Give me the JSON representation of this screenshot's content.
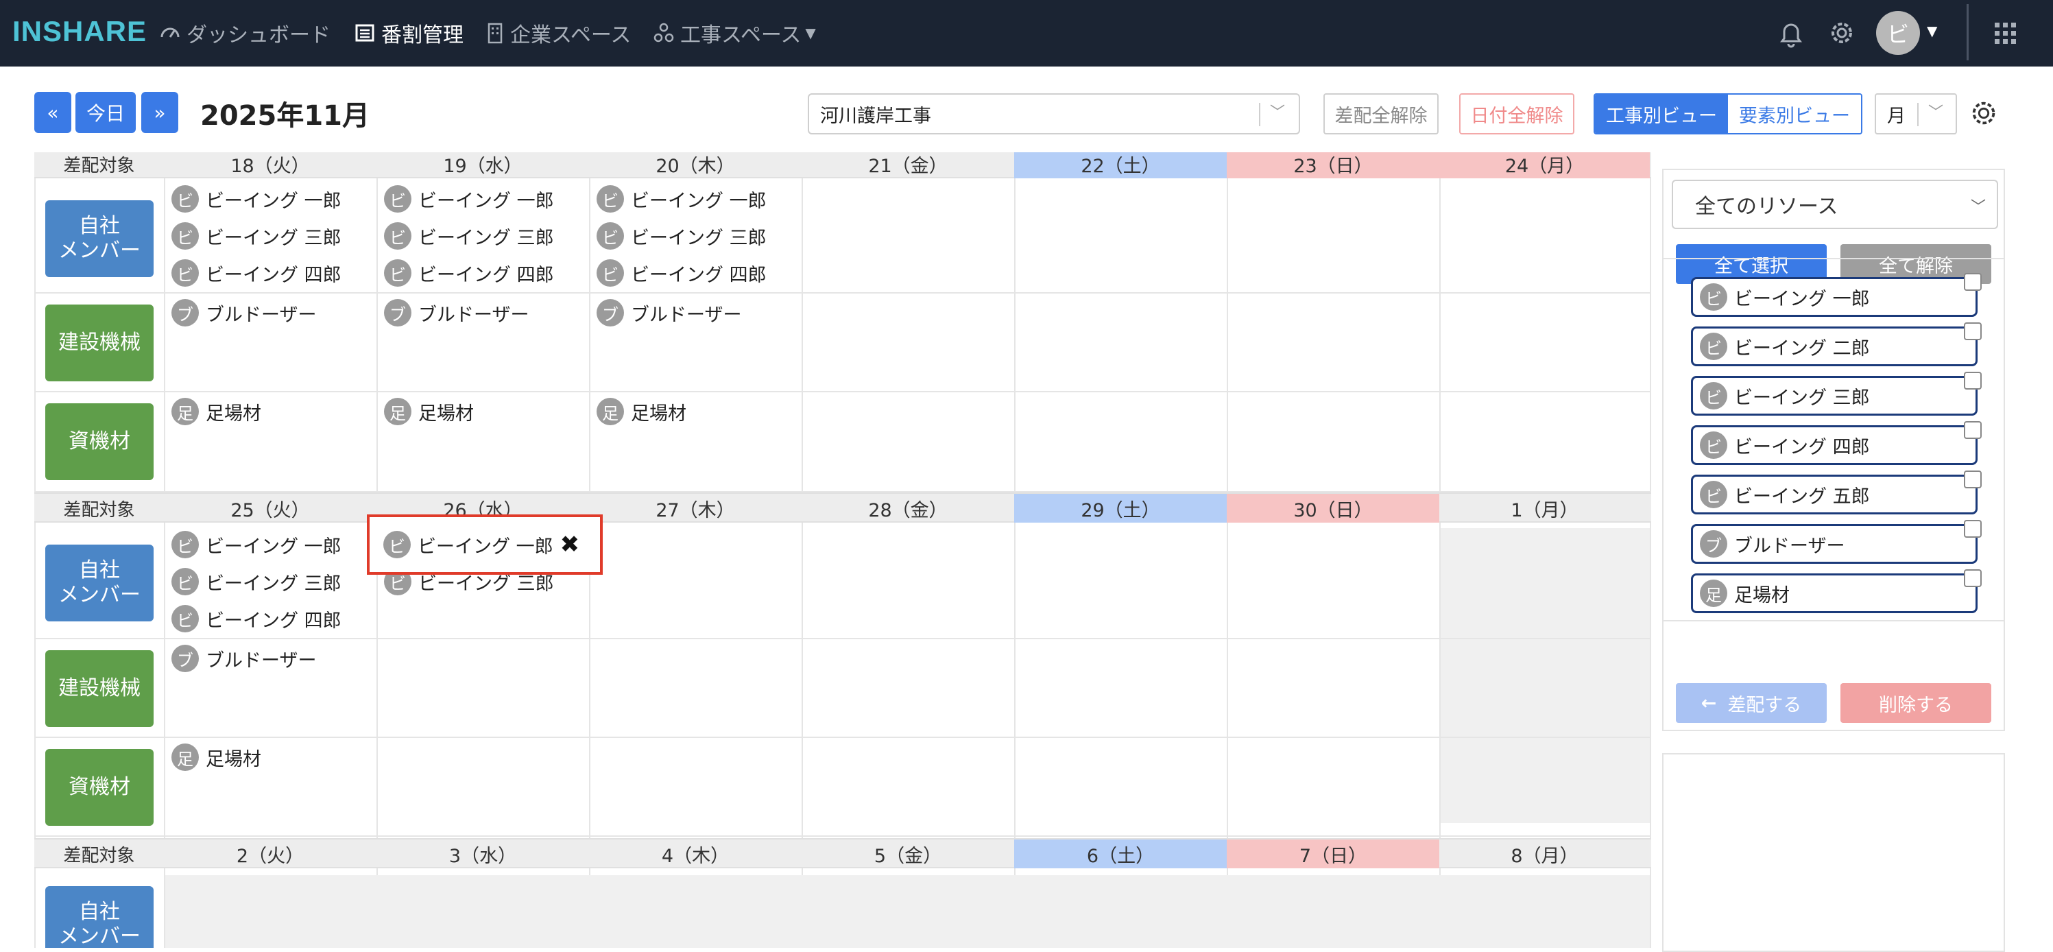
{
  "nav": {
    "logo": "INSHARE",
    "items": [
      {
        "label": "ダッシュボード",
        "icon": "dashboard-icon"
      },
      {
        "label": "番割管理",
        "icon": "list-icon"
      },
      {
        "label": "企業スペース",
        "icon": "building-icon"
      },
      {
        "label": "工事スペース",
        "icon": "network-icon"
      }
    ],
    "avatar": "ビ"
  },
  "toolbar": {
    "prev": "«",
    "today": "今日",
    "next": "»",
    "month_title": "2025年11月",
    "project": "河川護岸工事",
    "clear_assign": "差配全解除",
    "clear_date": "日付全解除",
    "view_by_project": "工事別ビュー",
    "view_by_element": "要素別ビュー",
    "period": "月"
  },
  "calendar": {
    "row_label": "差配対象",
    "categories": {
      "members": "自社\nメンバー",
      "machines": "建設機械",
      "materials": "資機材"
    },
    "weeks": [
      {
        "days": [
          "18（火）",
          "19（水）",
          "20（木）",
          "21（金）",
          "22（土）",
          "23（日）",
          "24（月）"
        ]
      },
      {
        "days": [
          "25（火）",
          "26（水）",
          "27（木）",
          "28（金）",
          "29（土）",
          "30（日）",
          "1（月）"
        ]
      },
      {
        "days": [
          "2（火）",
          "3（水）",
          "4（木）",
          "5（金）",
          "6（土）",
          "7（日）",
          "8（月）"
        ]
      }
    ],
    "chips": {
      "ichiro": {
        "avatar": "ビ",
        "label": "ビーイング 一郎"
      },
      "saburo": {
        "avatar": "ビ",
        "label": "ビーイング 三郎"
      },
      "shiro": {
        "avatar": "ビ",
        "label": "ビーイング 四郎"
      },
      "bulldozer": {
        "avatar": "ブ",
        "label": "ブルドーザー"
      },
      "scaffold": {
        "avatar": "足",
        "label": "足場材"
      }
    },
    "remove_mark": "✖"
  },
  "panel": {
    "resource_filter": "全てのリソース",
    "select_all": "全て選択",
    "deselect_all": "全て解除",
    "resources": [
      {
        "avatar": "ビ",
        "label": "ビーイング 一郎"
      },
      {
        "avatar": "ビ",
        "label": "ビーイング 二郎"
      },
      {
        "avatar": "ビ",
        "label": "ビーイング 三郎"
      },
      {
        "avatar": "ビ",
        "label": "ビーイング 四郎"
      },
      {
        "avatar": "ビ",
        "label": "ビーイング 五郎"
      },
      {
        "avatar": "ブ",
        "label": "ブルドーザー"
      },
      {
        "avatar": "足",
        "label": "足場材"
      }
    ],
    "assign": "差配する",
    "delete": "削除する"
  },
  "colors": {
    "navbar": "#1b2433",
    "accent": "#3a7ae6",
    "saturday": "#b4cef7",
    "sunday": "#f7c4c4",
    "member_category": "#4b86c7",
    "equipment_category": "#5f9e4a",
    "highlight": "#e03b2a"
  }
}
